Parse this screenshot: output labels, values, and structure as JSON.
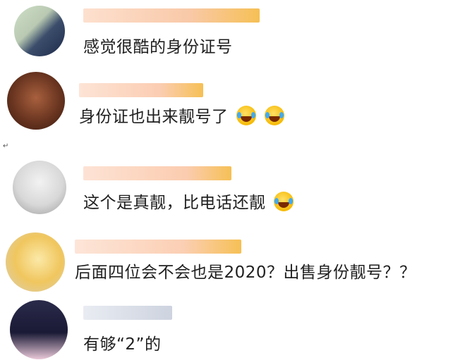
{
  "comments": [
    {
      "text": "感觉很酷的身份证号",
      "emoji_count": 0
    },
    {
      "text": "身份证也出来靓号了",
      "emoji_count": 2
    },
    {
      "text": "这个是真靓，比电话还靓",
      "emoji_count": 1
    },
    {
      "text": "后面四位会不会也是2020？出售身份靓号？？",
      "emoji_count": 0
    },
    {
      "text": "有够“2”的",
      "emoji_count": 0
    }
  ],
  "stray_mark": "↵",
  "icons": {
    "emoji": "laughing-crying-emoji-icon",
    "avatar": "blurred-avatar"
  }
}
